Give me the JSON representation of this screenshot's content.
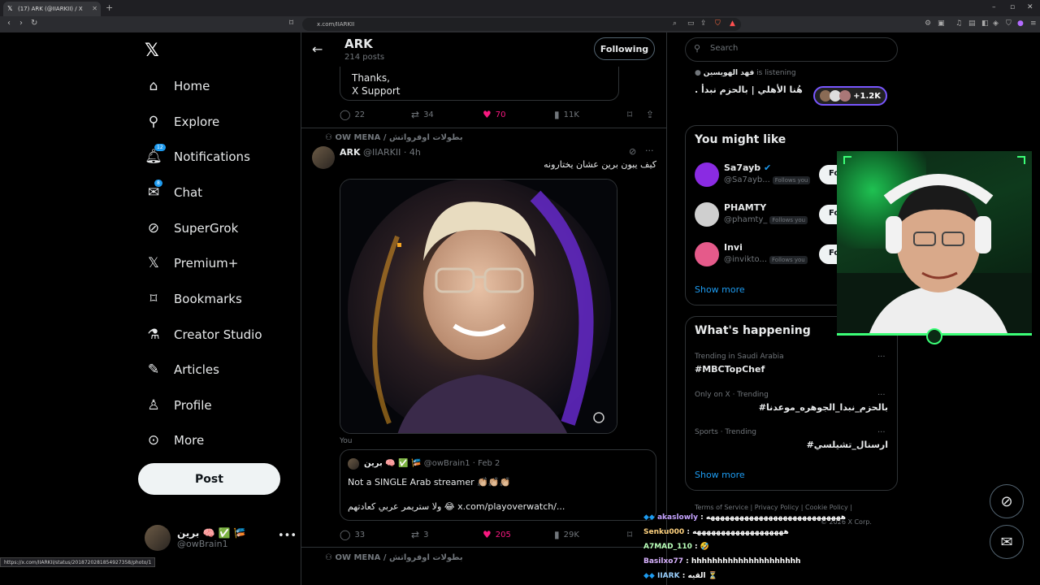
{
  "browser": {
    "tab_title": "(17) ARK (@IIARKII) / X",
    "url": "x.com/IIARKII",
    "status_url": "https://x.com/IIARKII/status/2018720281854927358/photo/1"
  },
  "nav": {
    "items": [
      {
        "label": "Home",
        "icon": "home-icon"
      },
      {
        "label": "Explore",
        "icon": "search-icon"
      },
      {
        "label": "Notifications",
        "icon": "bell-icon",
        "badge": "12"
      },
      {
        "label": "Chat",
        "icon": "mail-icon",
        "badge": "8"
      },
      {
        "label": "SuperGrok",
        "icon": "grok-icon"
      },
      {
        "label": "Premium+",
        "icon": "x-icon"
      },
      {
        "label": "Bookmarks",
        "icon": "bookmark-icon"
      },
      {
        "label": "Creator Studio",
        "icon": "flask-icon"
      },
      {
        "label": "Articles",
        "icon": "article-icon"
      },
      {
        "label": "Profile",
        "icon": "person-icon"
      },
      {
        "label": "More",
        "icon": "more-circle-icon"
      }
    ],
    "post_label": "Post",
    "account": {
      "name": "برين 🧠 ✅ 🎏",
      "handle": "@owBrain1"
    }
  },
  "header": {
    "title": "ARK",
    "subtitle": "214 posts",
    "following_label": "Following"
  },
  "prev_tweet": {
    "text_line1": "Thanks,",
    "text_line2": "X Support",
    "replies": "22",
    "reposts": "34",
    "likes": "70",
    "views": "11K"
  },
  "tweet": {
    "context": "OW MENA / بطولات اوفرواتش",
    "name": "ARK",
    "handle": "@IIARKII",
    "time": "· 4h",
    "text": "كيف يبون برين عشان يختارونه",
    "you_label": "You",
    "quote": {
      "name": "برين 🧠 ✅ 🎏",
      "handle": "@owBrain1",
      "date": "· Feb 2",
      "line1": "Not a SINGLE Arab streamer 👏🏼👏🏼👏🏼",
      "line2": "ولا ستريمر عربي كعادتهم 😂 x.com/playoverwatch/..."
    },
    "replies": "33",
    "reposts": "3",
    "likes": "205",
    "views": "29K"
  },
  "next_context": "OW MENA / بطولات اوفرواتش",
  "search": {
    "placeholder": "Search"
  },
  "space": {
    "host": "فهد الهويسين",
    "listening": "is listening",
    "title": "هُنا الأهلي | بالحزم نبدأ .",
    "count": "+1.2K"
  },
  "who_to_follow": {
    "title": "You might like",
    "users": [
      {
        "name": "Sa7ayb",
        "handle": "@Sa7ayb...",
        "follows_you": "Follows you",
        "btn": "Fo"
      },
      {
        "name": "PHAMTY",
        "handle": "@phamty_",
        "follows_you": "Follows you",
        "btn": "Fo"
      },
      {
        "name": "Invi",
        "handle": "@invikto...",
        "follows_you": "Follows you",
        "btn": "Fo"
      }
    ],
    "show_more": "Show more"
  },
  "happening": {
    "title": "What's happening",
    "trends": [
      {
        "context": "Trending in Saudi Arabia",
        "topic": "#MBCTopChef"
      },
      {
        "context": "Only on X · Trending",
        "topic": "#بالحزم_نبدا_الجوهره_موعدنا"
      },
      {
        "context": "Sports · Trending",
        "topic": "#ارسنال_تشيلسي"
      }
    ],
    "show_more": "Show more"
  },
  "footer": {
    "links": "Terms of Service  |  Privacy Policy  |  Cookie Policy  |",
    "copyright": "© 2026 X Corp."
  },
  "chat": [
    {
      "user": "akaslowly",
      "msg": ": ههههههههههههههههههههههههههههه"
    },
    {
      "user": "Senku000",
      "msg": ": هههههههههههههههههههه"
    },
    {
      "user": "A7MAD_110",
      "msg": ": 🤣"
    },
    {
      "user": "Basilxo77",
      "msg": ": hhhhhhhhhhhhhhhhhhhhh"
    },
    {
      "user": "IIARK",
      "msg": ": القيه ⏳"
    }
  ],
  "colors": {
    "accent": "#1d9bf0",
    "like": "#f91880",
    "spaces": "#7856ff",
    "cam_border": "#3cff78"
  }
}
